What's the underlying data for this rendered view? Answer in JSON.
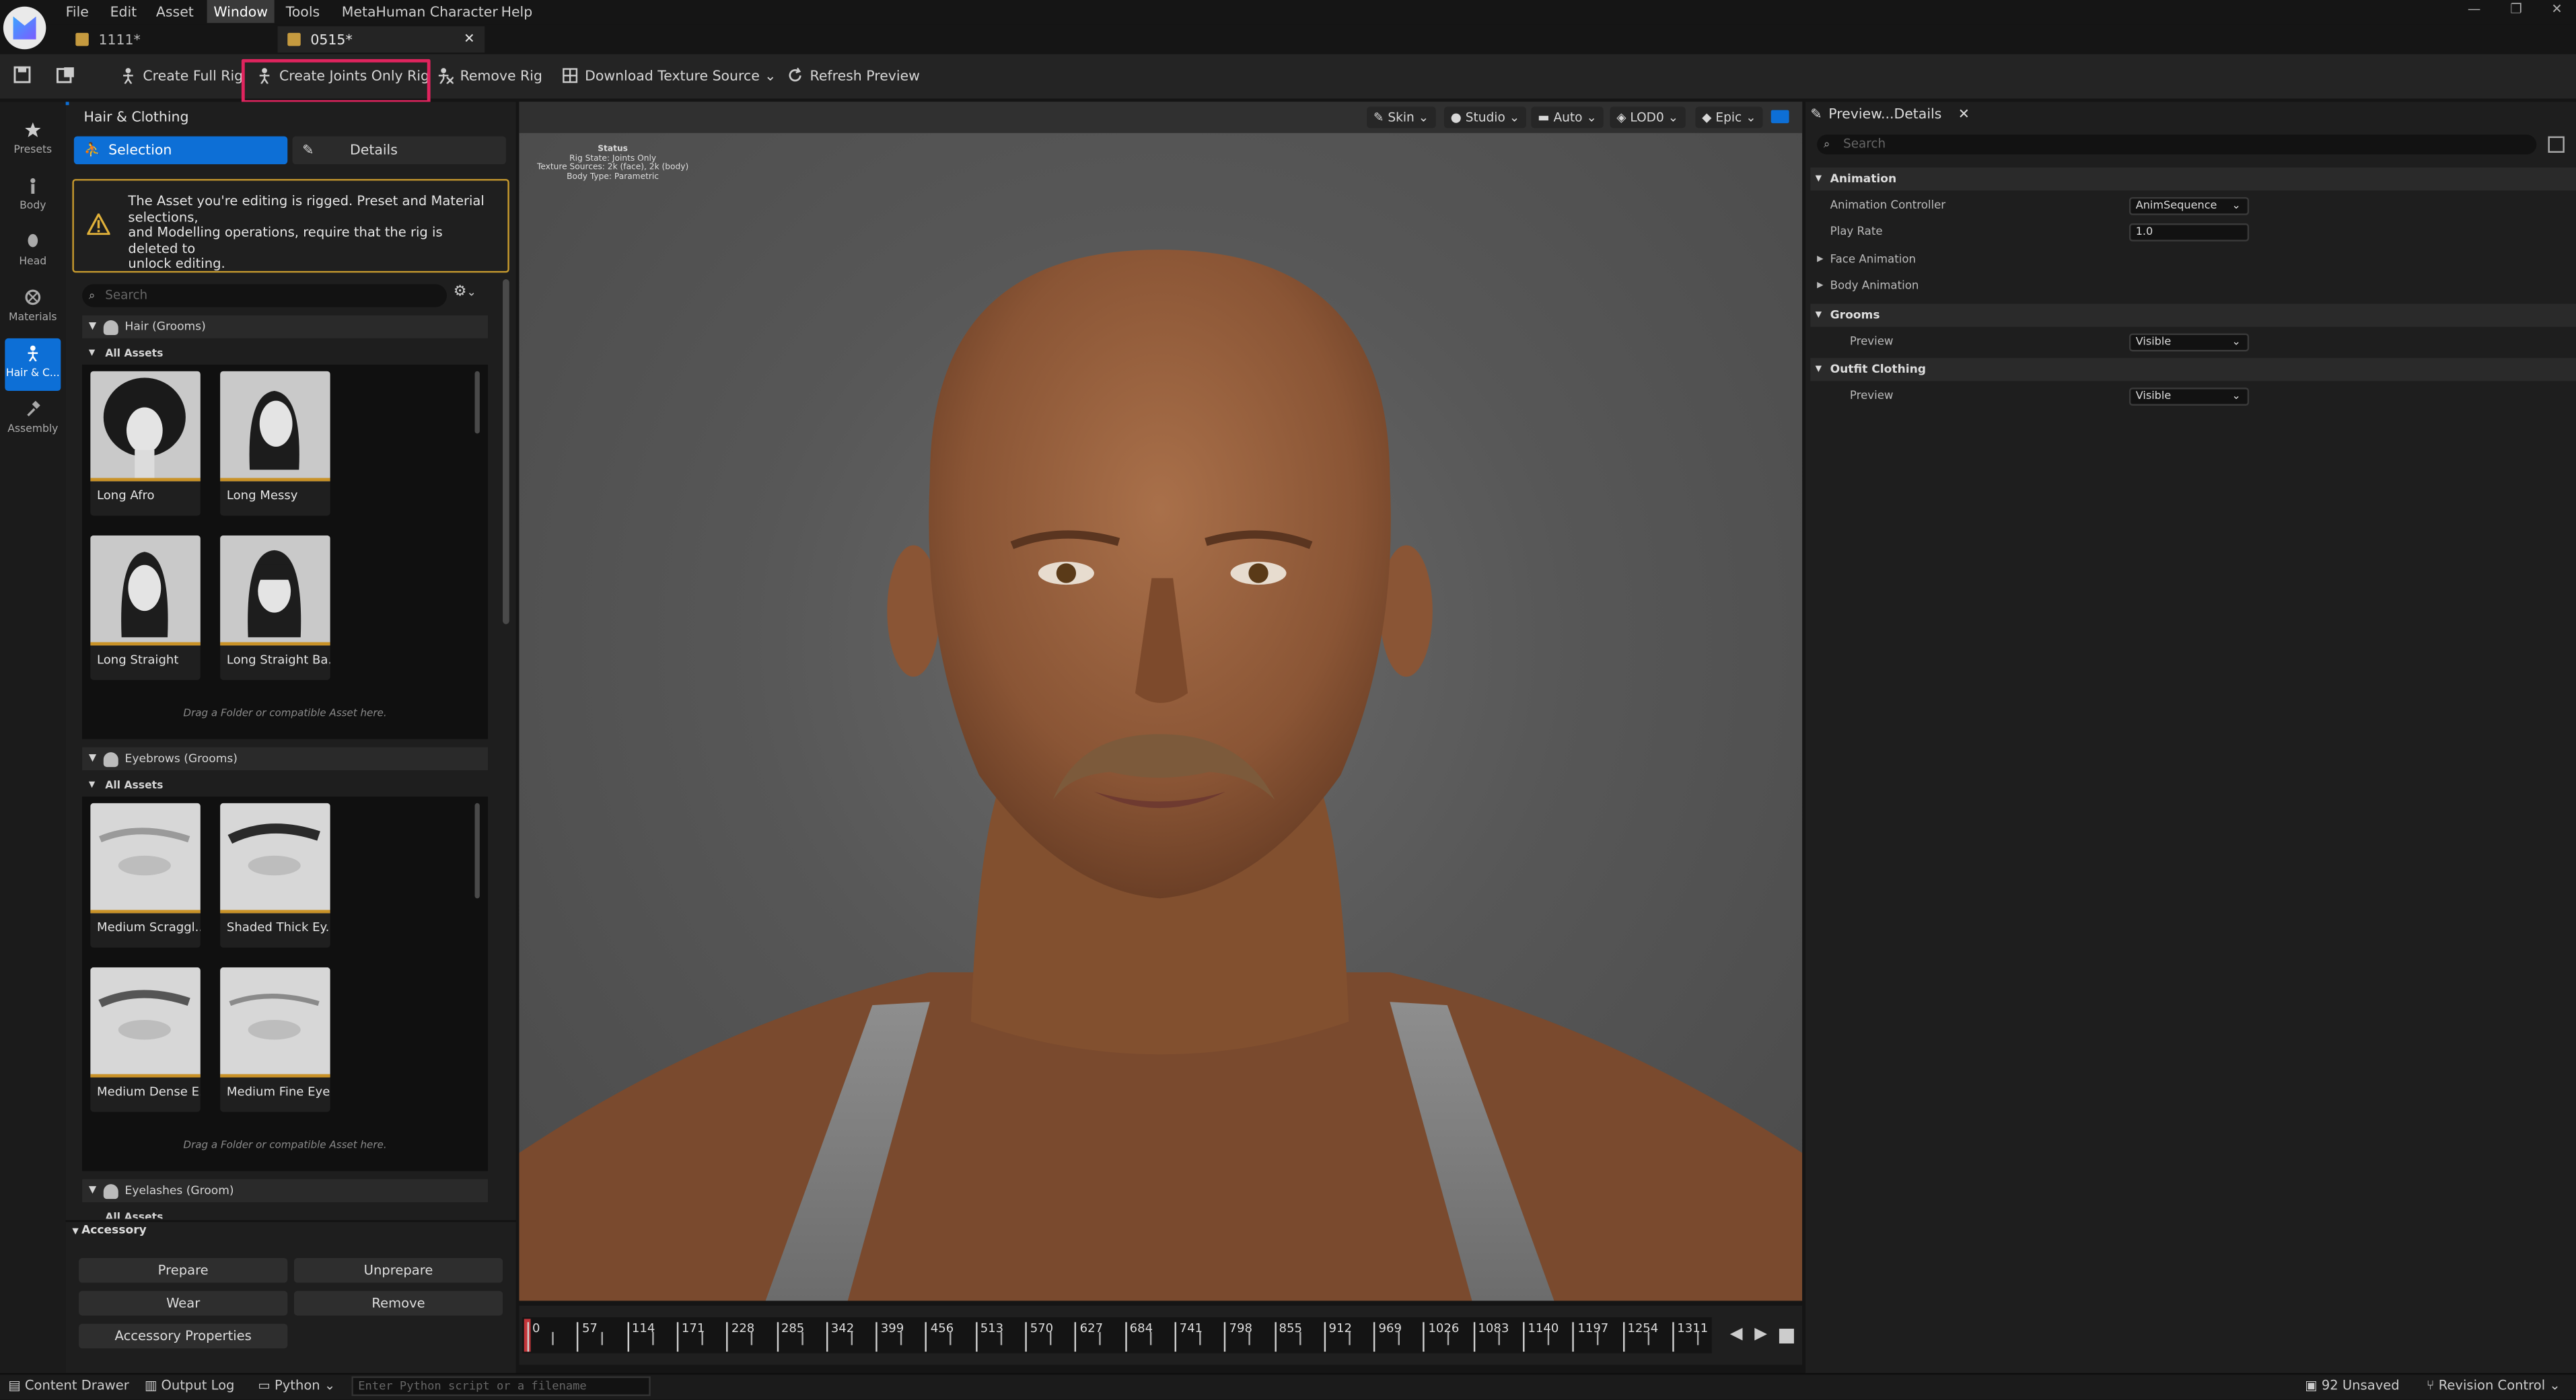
{
  "menu": {
    "items": [
      "File",
      "Edit",
      "Asset",
      "Window",
      "Tools",
      "MetaHuman Character",
      "Help"
    ],
    "active": "Window"
  },
  "tabs": [
    {
      "label": "1111*"
    },
    {
      "label": "0515*"
    }
  ],
  "toolbar": {
    "create_full_rig": "Create Full Rig",
    "create_joints_only_rig": "Create Joints Only Rig",
    "remove_rig": "Remove Rig",
    "download_texture_source": "Download Texture Source",
    "refresh_preview": "Refresh Preview"
  },
  "rail": [
    {
      "label": "Presets"
    },
    {
      "label": "Body"
    },
    {
      "label": "Head"
    },
    {
      "label": "Materials"
    },
    {
      "label": "Hair & C..."
    },
    {
      "label": "Assembly"
    }
  ],
  "panel": {
    "title": "Hair & Clothing",
    "selection_tab": "Selection",
    "details_tab": "Details",
    "warning": "The Asset you're editing is rigged. Preset and Material selections, and Modelling operations, require that the rig is deleted to unlock editing.",
    "warning_l1": "The Asset you're editing is rigged. Preset and Material",
    "warning_l2": "selections,",
    "warning_l3": "and Modelling operations, require that the rig is deleted to",
    "warning_l4": "unlock editing.",
    "search_placeholder": "Search",
    "hair_section": "Hair (Grooms)",
    "all_assets": "All Assets",
    "hair_assets": [
      "Long Afro",
      "Long Messy",
      "Long Straight",
      "Long Straight Ba..."
    ],
    "drag_hint": "Drag a Folder or compatible Asset here.",
    "eyebrows_section": "Eyebrows (Grooms)",
    "eyebrow_assets": [
      "Medium Scraggl...",
      "Shaded Thick Ey...",
      "Medium Dense E...",
      "Medium Fine Eye..."
    ],
    "eyelashes_section": "Eyelashes (Groom)",
    "eyelashes_sub": "All Assets"
  },
  "accessory": {
    "title": "Accessory",
    "prepare": "Prepare",
    "unprepare": "Unprepare",
    "wear": "Wear",
    "remove": "Remove",
    "properties": "Accessory Properties"
  },
  "viewport": {
    "chips": [
      "Skin",
      "Studio",
      "Auto",
      "LOD0",
      "Epic"
    ],
    "status_title": "Status",
    "status_rig": "Rig State: Joints Only",
    "status_tex": "Texture Sources: 2k (face), 2k (body)",
    "status_body": "Body Type: Parametric"
  },
  "timeline": {
    "ticks": [
      "0",
      "57",
      "114",
      "171",
      "228",
      "285",
      "342",
      "399",
      "456",
      "513",
      "570",
      "627",
      "684",
      "741",
      "798",
      "855",
      "912",
      "969",
      "1026",
      "1083",
      "1140",
      "1197",
      "1254",
      "1311"
    ]
  },
  "details": {
    "tab": "Preview...Details",
    "search_placeholder": "Search",
    "animation": "Animation",
    "animation_controller": "Animation Controller",
    "animation_controller_value": "AnimSequence",
    "play_rate": "Play Rate",
    "play_rate_value": "1.0",
    "face_animation": "Face Animation",
    "body_animation": "Body Animation",
    "grooms": "Grooms",
    "grooms_preview": "Preview",
    "grooms_preview_value": "Visible",
    "outfit_clothing": "Outfit Clothing",
    "outfit_preview": "Preview",
    "outfit_preview_value": "Visible"
  },
  "statusbar": {
    "content_drawer": "Content Drawer",
    "output_log": "Output Log",
    "python": "Python",
    "python_placeholder": "Enter Python script or a filename",
    "unsaved": "92 Unsaved",
    "revision_control": "Revision Control"
  },
  "colors": {
    "accent": "#0d6fd6",
    "highlight": "#e0245e",
    "warning": "#c79a2e"
  }
}
